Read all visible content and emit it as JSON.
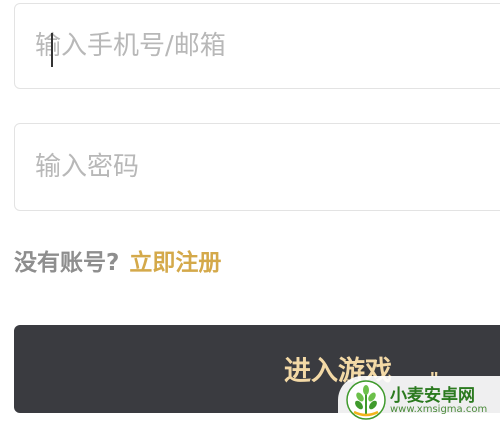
{
  "login_form": {
    "phone_email_field": {
      "value": "",
      "placeholder": "输入手机号/邮箱"
    },
    "password_field": {
      "value": "",
      "placeholder": "输入密码"
    },
    "signup_prompt": "没有账号?",
    "signup_link": "立即注册",
    "enter_game_button": "进入游戏",
    "button_decoration": "\"",
    "colors": {
      "button_bg": "#3a3b40",
      "button_text": "#f3d9a6",
      "link": "#d4a94a",
      "muted_text": "#8e8e8e",
      "placeholder": "#b8b8b8",
      "border": "#e3e3e3"
    }
  },
  "watermark": {
    "title": "小麦安卓网",
    "url": "www.xmsigma.com",
    "icon": "wheat-logo-icon"
  }
}
